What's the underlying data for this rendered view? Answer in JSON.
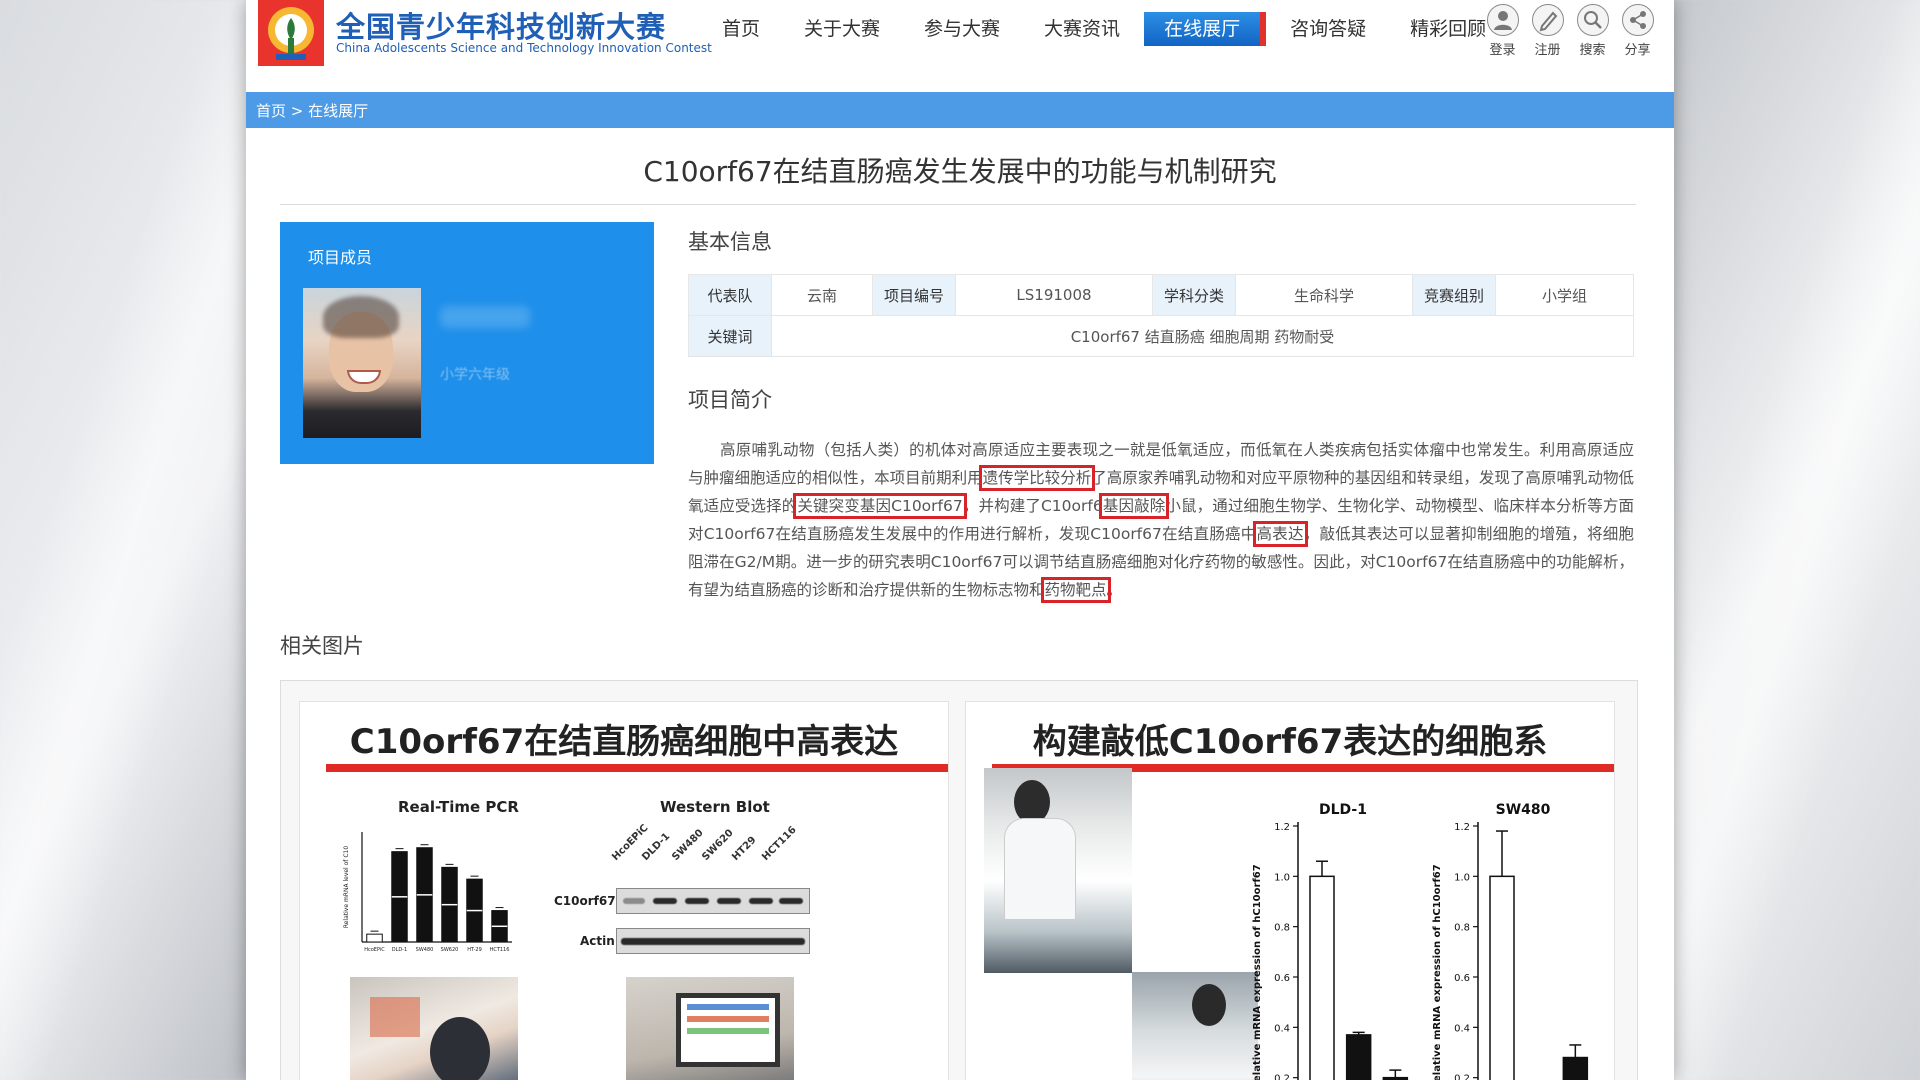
{
  "site": {
    "name_cn": "全国青少年科技创新大赛",
    "name_en": "China Adolescents Science and Technology Innovation Contest"
  },
  "nav": [
    {
      "label": "首页"
    },
    {
      "label": "关于大赛"
    },
    {
      "label": "参与大赛"
    },
    {
      "label": "大赛资讯"
    },
    {
      "label": "在线展厅",
      "active": true
    },
    {
      "label": "咨询答疑"
    },
    {
      "label": "精彩回顾"
    }
  ],
  "tools": [
    {
      "label": "登录",
      "icon": "user-icon"
    },
    {
      "label": "注册",
      "icon": "pencil-icon"
    },
    {
      "label": "搜索",
      "icon": "search-icon"
    },
    {
      "label": "分享",
      "icon": "share-icon"
    }
  ],
  "breadcrumb": {
    "home": "首页",
    "sep": ">",
    "current": "在线展厅"
  },
  "project": {
    "title": "C10orf67在结直肠癌发生发展中的功能与机制研究",
    "members_heading": "项目成员",
    "member_grade": "小学六年级",
    "basic_info_heading": "基本信息",
    "info": {
      "team_label": "代表队",
      "team": "云南",
      "id_label": "项目编号",
      "id": "LS191008",
      "subject_label": "学科分类",
      "subject": "生命科学",
      "group_label": "竞赛组别",
      "group": "小学组",
      "keywords_label": "关键词",
      "keywords": "C10orf67 结直肠癌 细胞周期 药物耐受"
    },
    "summary_heading": "项目简介",
    "summary": {
      "p1": "高原哺乳动物（包括人类）的机体对高原适应主要表现之一就是低氧适应，而低氧在人类疾病包括实体瘤中也常发生。利用高原适应与肿瘤细胞适应的相似性，本项目前期利用",
      "h1": "遗传学比较分析",
      "p2": "了高原家养哺乳动物和对应平原物种的基因组和转录组，发现了高原哺乳动物低氧适应受选择的",
      "h2": "关键突变基因C10orf67",
      "p3": "，并构建了C10orf6",
      "h3": "基因敲除",
      "p4": "小鼠，通过细胞生物学、生物化学、动物模型、临床样本分析等方面对C10orf67在结直肠癌发生发展中的作用进行解析，发现C10orf67在结直肠癌中",
      "h4": "高表达",
      "p5": "，敲低其表达可以显著抑制细胞的增殖，将细胞阻滞在G2/M期。进一步的研究表明C10orf67可以调节结直肠癌细胞对化疗药物的敏感性。因此，对C10orf67在结直肠癌中的功能解析，有望为结直肠癌的诊断和治疗提供新的生物标志物和",
      "h5": "药物靶点",
      "p6": "。"
    },
    "related_heading": "相关图片"
  },
  "figure_left": {
    "title": "C10orf67在结直肠癌细胞中高表达",
    "pcr_title": "Real-Time PCR",
    "pcr_ylabel": "Relative mRNA level of C10",
    "wb_title": "Western Blot",
    "wb_lanes": [
      "HcoEPiC",
      "DLD-1",
      "SW480",
      "SW620",
      "HT29",
      "HCT116"
    ],
    "wb_rows": [
      "C10orf67",
      "Actin"
    ]
  },
  "figure_right": {
    "title": "构建敲低C10orf67表达的细胞系",
    "chart_ylabel": "Relative mRNA expression of hC10orf67"
  },
  "chart_data": [
    {
      "type": "bar",
      "title": "Real-Time PCR",
      "ylabel": "Relative mRNA level of C10",
      "categories": [
        "HcoEPiC",
        "DLD-1",
        "SW480",
        "SW620",
        "HT-29",
        "HCT116"
      ],
      "values": [
        1,
        11.5,
        12,
        9.5,
        8,
        4
      ],
      "ylim": [
        0,
        14
      ]
    },
    {
      "type": "bar",
      "title": "DLD-1",
      "ylabel": "Relative mRNA expression of hC10orf67",
      "categories": [
        "",
        "",
        ""
      ],
      "values": [
        1.0,
        0.37,
        0.2
      ],
      "errors": [
        0.06,
        0.01,
        0.03
      ],
      "fills": [
        "#ffffff",
        "#111111",
        "#111111"
      ],
      "ylim": [
        0,
        1.2
      ],
      "yticks": [
        0.2,
        0.4,
        0.6,
        0.8,
        1.0,
        1.2
      ]
    },
    {
      "type": "bar",
      "title": "SW480",
      "ylabel": "Relative mRNA expression of hC10orf67",
      "categories": [
        "",
        "",
        ""
      ],
      "values": [
        1.0,
        0.03,
        0.28
      ],
      "errors": [
        0.18,
        0.0,
        0.05
      ],
      "fills": [
        "#ffffff",
        "#111111",
        "#111111"
      ],
      "ylim": [
        0,
        1.2
      ],
      "yticks": [
        0.2,
        0.4,
        0.6,
        0.8,
        1.0,
        1.2
      ]
    }
  ]
}
